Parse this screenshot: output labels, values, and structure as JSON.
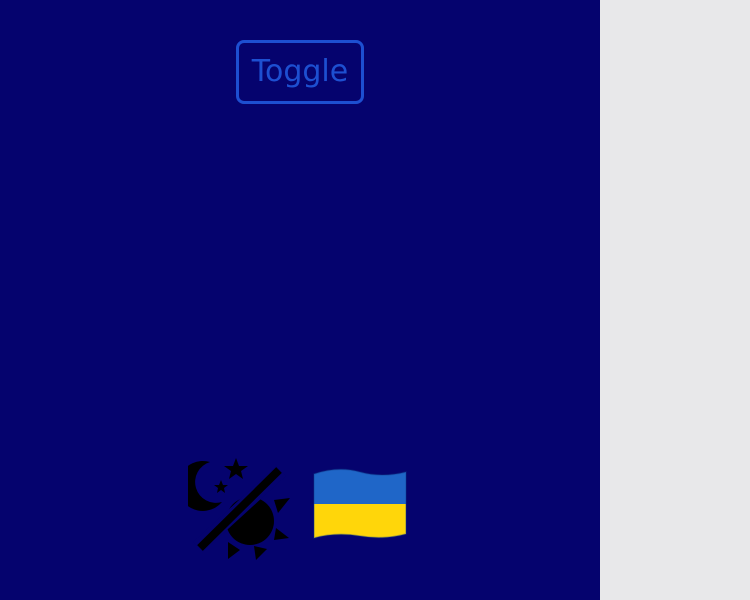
{
  "toggle": {
    "label": "Toggle"
  },
  "icons": {
    "theme": "moon-sun-toggle-icon",
    "flag": "ukraine-flag-icon"
  },
  "colors": {
    "background": "#05036e",
    "button_accent": "#1d4fd1",
    "sidebar": "#e8e8ea",
    "flag_blue": "#1f66c8",
    "flag_yellow": "#ffd60a"
  }
}
